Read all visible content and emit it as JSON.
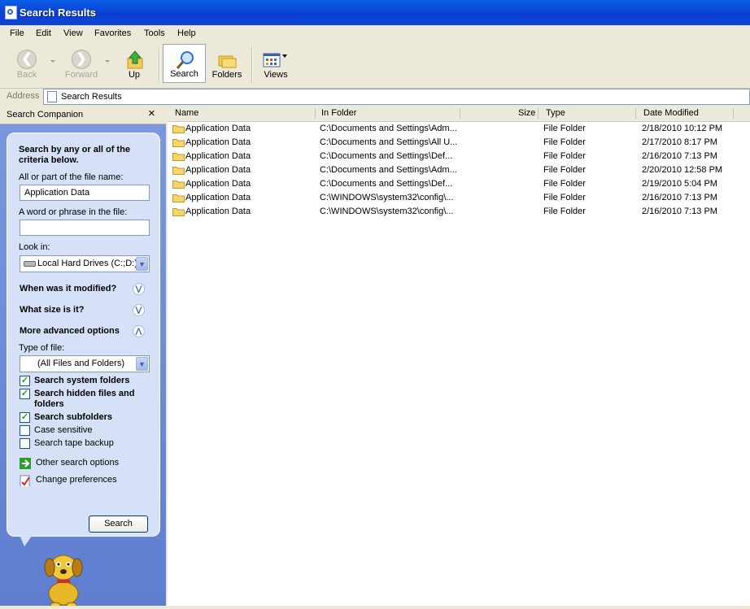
{
  "window": {
    "title": "Search Results"
  },
  "menu": [
    "File",
    "Edit",
    "View",
    "Favorites",
    "Tools",
    "Help"
  ],
  "toolbar": {
    "back": "Back",
    "forward": "Forward",
    "up": "Up",
    "search": "Search",
    "folders": "Folders",
    "views": "Views"
  },
  "address": {
    "label": "Address",
    "value": "Search Results"
  },
  "search_panel": {
    "title": "Search Companion",
    "close": "×",
    "heading": "Search by any or all of the criteria below.",
    "filename_label": "All or part of the file name:",
    "filename_value": "Application Data",
    "phrase_label": "A word or phrase in the file:",
    "phrase_value": "",
    "lookin_label": "Look in:",
    "lookin_value": "Local Hard Drives (C:;D:)",
    "modified_link": "When was it modified?",
    "size_link": "What size is it?",
    "advanced_link": "More advanced options",
    "type_label": "Type of file:",
    "type_value": "(All Files and Folders)",
    "options": [
      {
        "label": "Search system folders",
        "checked": true
      },
      {
        "label": "Search hidden files and folders",
        "checked": true
      },
      {
        "label": "Search subfolders",
        "checked": true
      },
      {
        "label": "Case sensitive",
        "checked": false
      },
      {
        "label": "Search tape backup",
        "checked": false
      }
    ],
    "other_options": "Other search options",
    "change_prefs": "Change preferences",
    "search_button": "Search"
  },
  "results": {
    "columns": [
      "Name",
      "In Folder",
      "Size",
      "Type",
      "Date Modified"
    ],
    "rows": [
      {
        "name": "Application Data",
        "folder": "C:\\Documents and Settings\\Adm...",
        "size": "",
        "type": "File Folder",
        "date": "2/18/2010 10:12 PM"
      },
      {
        "name": "Application Data",
        "folder": "C:\\Documents and Settings\\All U...",
        "size": "",
        "type": "File Folder",
        "date": "2/17/2010 8:17 PM"
      },
      {
        "name": "Application Data",
        "folder": "C:\\Documents and Settings\\Def...",
        "size": "",
        "type": "File Folder",
        "date": "2/16/2010 7:13 PM"
      },
      {
        "name": "Application Data",
        "folder": "C:\\Documents and Settings\\Adm...",
        "size": "",
        "type": "File Folder",
        "date": "2/20/2010 12:58 PM"
      },
      {
        "name": "Application Data",
        "folder": "C:\\Documents and Settings\\Def...",
        "size": "",
        "type": "File Folder",
        "date": "2/19/2010 5:04 PM"
      },
      {
        "name": "Application Data",
        "folder": "C:\\WINDOWS\\system32\\config\\...",
        "size": "",
        "type": "File Folder",
        "date": "2/16/2010 7:13 PM"
      },
      {
        "name": "Application Data",
        "folder": "C:\\WINDOWS\\system32\\config\\...",
        "size": "",
        "type": "File Folder",
        "date": "2/16/2010 7:13 PM"
      }
    ]
  },
  "colors": {
    "title_bar": "#0a3fd0",
    "panel_bg": "#6c8ad8",
    "bubble_bg": "#d6e0f7"
  }
}
